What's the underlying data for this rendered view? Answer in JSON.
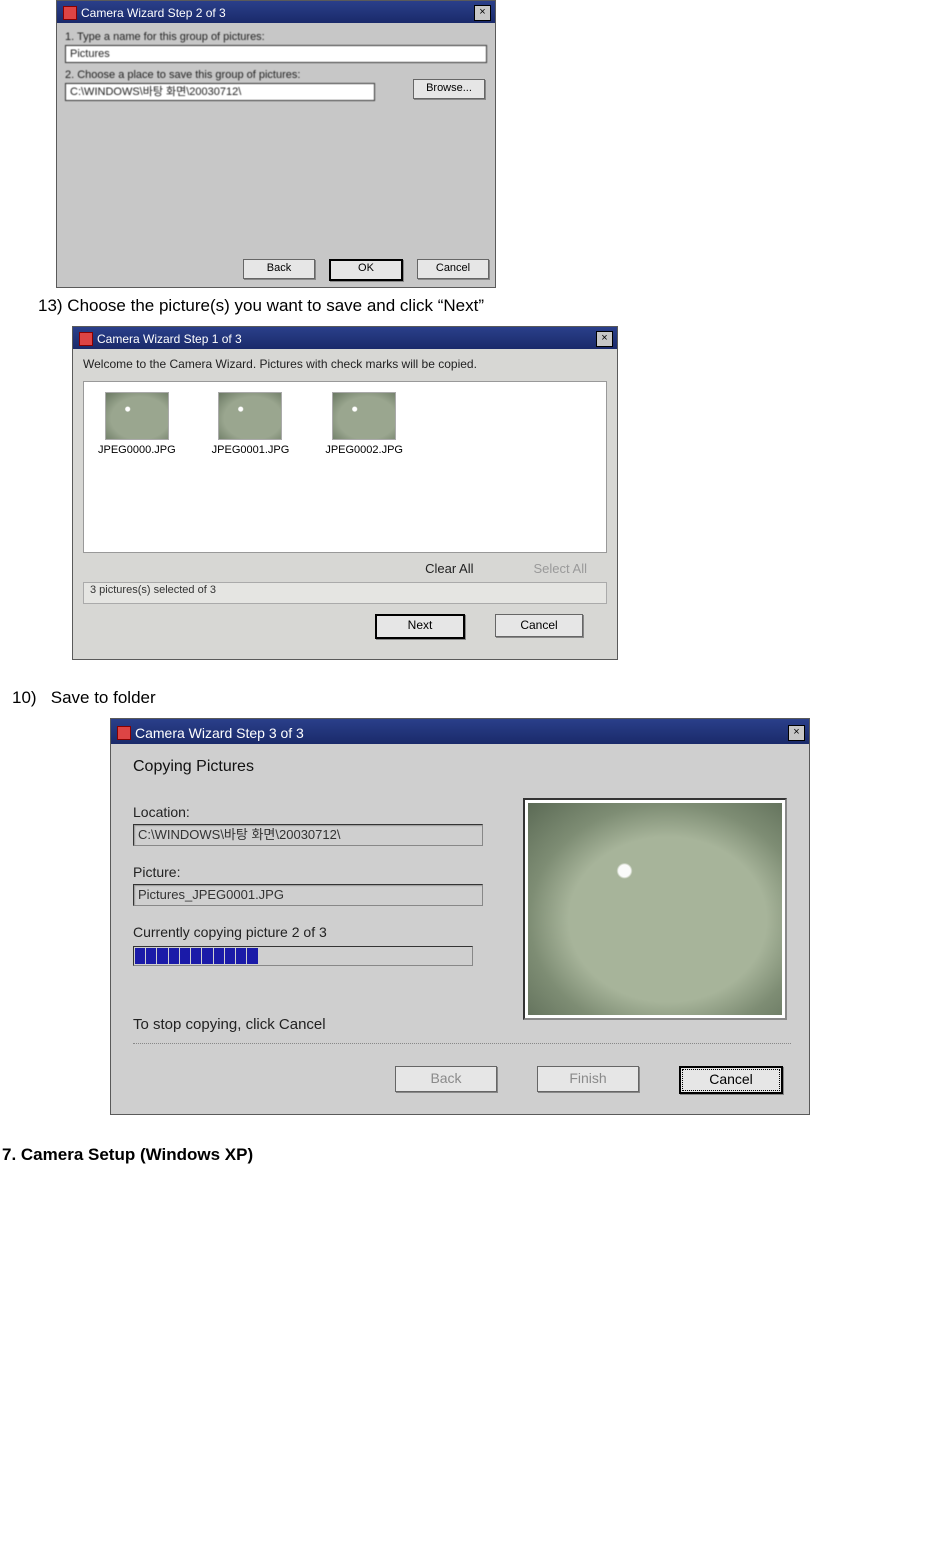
{
  "dialog1": {
    "title": "Camera Wizard Step 2 of 3",
    "label1": "1. Type a name for this group of pictures:",
    "field1": "Pictures",
    "label2": "2. Choose a place to save this group of pictures:",
    "field2": "C:\\WINDOWS\\바탕 화면\\20030712\\",
    "browse": "Browse...",
    "back": "Back",
    "ok": "OK",
    "cancel": "Cancel"
  },
  "instr13": "13) Choose the picture(s) you want to save and click “Next”",
  "dialog2": {
    "title": "Camera Wizard Step 1 of 3",
    "blurb": "Welcome to the Camera Wizard.  Pictures with check marks will be copied.",
    "thumbs": [
      "JPEG0000.JPG",
      "JPEG0001.JPG",
      "JPEG0002.JPG"
    ],
    "clear": "Clear All",
    "select": "Select All",
    "status": "3 pictures(s) selected of 3",
    "next": "Next",
    "cancel": "Cancel"
  },
  "instr10": "10)   Save to folder",
  "dialog3": {
    "title": "Camera Wizard Step 3 of 3",
    "heading": "Copying Pictures",
    "location_label": "Location:",
    "location": "C:\\WINDOWS\\바탕 화면\\20030712\\",
    "picture_label": "Picture:",
    "picture": "Pictures_JPEG0001.JPG",
    "progress_line": "Currently copying picture 2 of 3",
    "progress_segments": 30,
    "progress_filled": 11,
    "stop_line": "To stop copying, click Cancel",
    "back": "Back",
    "finish": "Finish",
    "cancel": "Cancel"
  },
  "section7": "7. Camera Setup (Windows XP)"
}
